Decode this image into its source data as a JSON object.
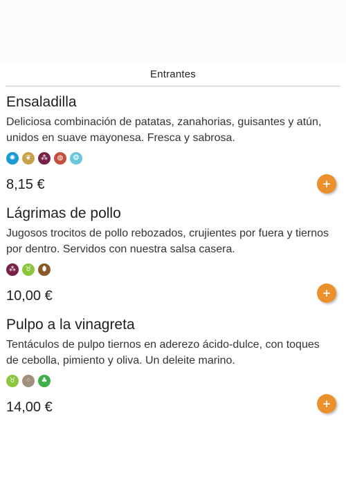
{
  "section": {
    "title": "Entrantes"
  },
  "items": [
    {
      "name": "Ensaladilla",
      "description": "Deliciosa combinación de patatas, zanahorias, guisantes y atún, unidos en suave mayonesa. Fresca y sabrosa.",
      "price": "8,15 €",
      "add_label": "+",
      "allergens": [
        {
          "icon": "crustacean-icon",
          "color": "#1a9ad6",
          "glyph": "✺"
        },
        {
          "icon": "gluten-icon",
          "color": "#c9a14a",
          "glyph": "❦"
        },
        {
          "icon": "sulphites-icon",
          "color": "#7a2047",
          "glyph": "⁂"
        },
        {
          "icon": "egg-icon",
          "color": "#c0513c",
          "glyph": "◍"
        },
        {
          "icon": "mollusc-icon",
          "color": "#69c6dc",
          "glyph": "❂"
        }
      ]
    },
    {
      "name": "Lágrimas de pollo",
      "description": "Jugosos trocitos de pollo rebozados, crujientes por fuera y tiernos por dentro. Servidos con nuestra salsa casera.",
      "price": "10,00 €",
      "add_label": "+",
      "allergens": [
        {
          "icon": "sulphites-icon",
          "color": "#7a2047",
          "glyph": "⁂"
        },
        {
          "icon": "mustard-icon",
          "color": "#8cc63f",
          "glyph": "♉"
        },
        {
          "icon": "peanut-icon",
          "color": "#8b5a2b",
          "glyph": "⬮"
        }
      ]
    },
    {
      "name": "Pulpo a la vinagreta",
      "description": "Tentáculos de pulpo tiernos en aderezo ácido-dulce, con toques de cebolla, pimiento y oliva. Un deleite marino.",
      "price": "14,00 €",
      "add_label": "+",
      "allergens": [
        {
          "icon": "mustard-icon",
          "color": "#8cc63f",
          "glyph": "♉"
        },
        {
          "icon": "sesame-icon",
          "color": "#a0907c",
          "glyph": "⁘"
        },
        {
          "icon": "celery-icon",
          "color": "#3fae49",
          "glyph": "♣"
        }
      ]
    }
  ]
}
